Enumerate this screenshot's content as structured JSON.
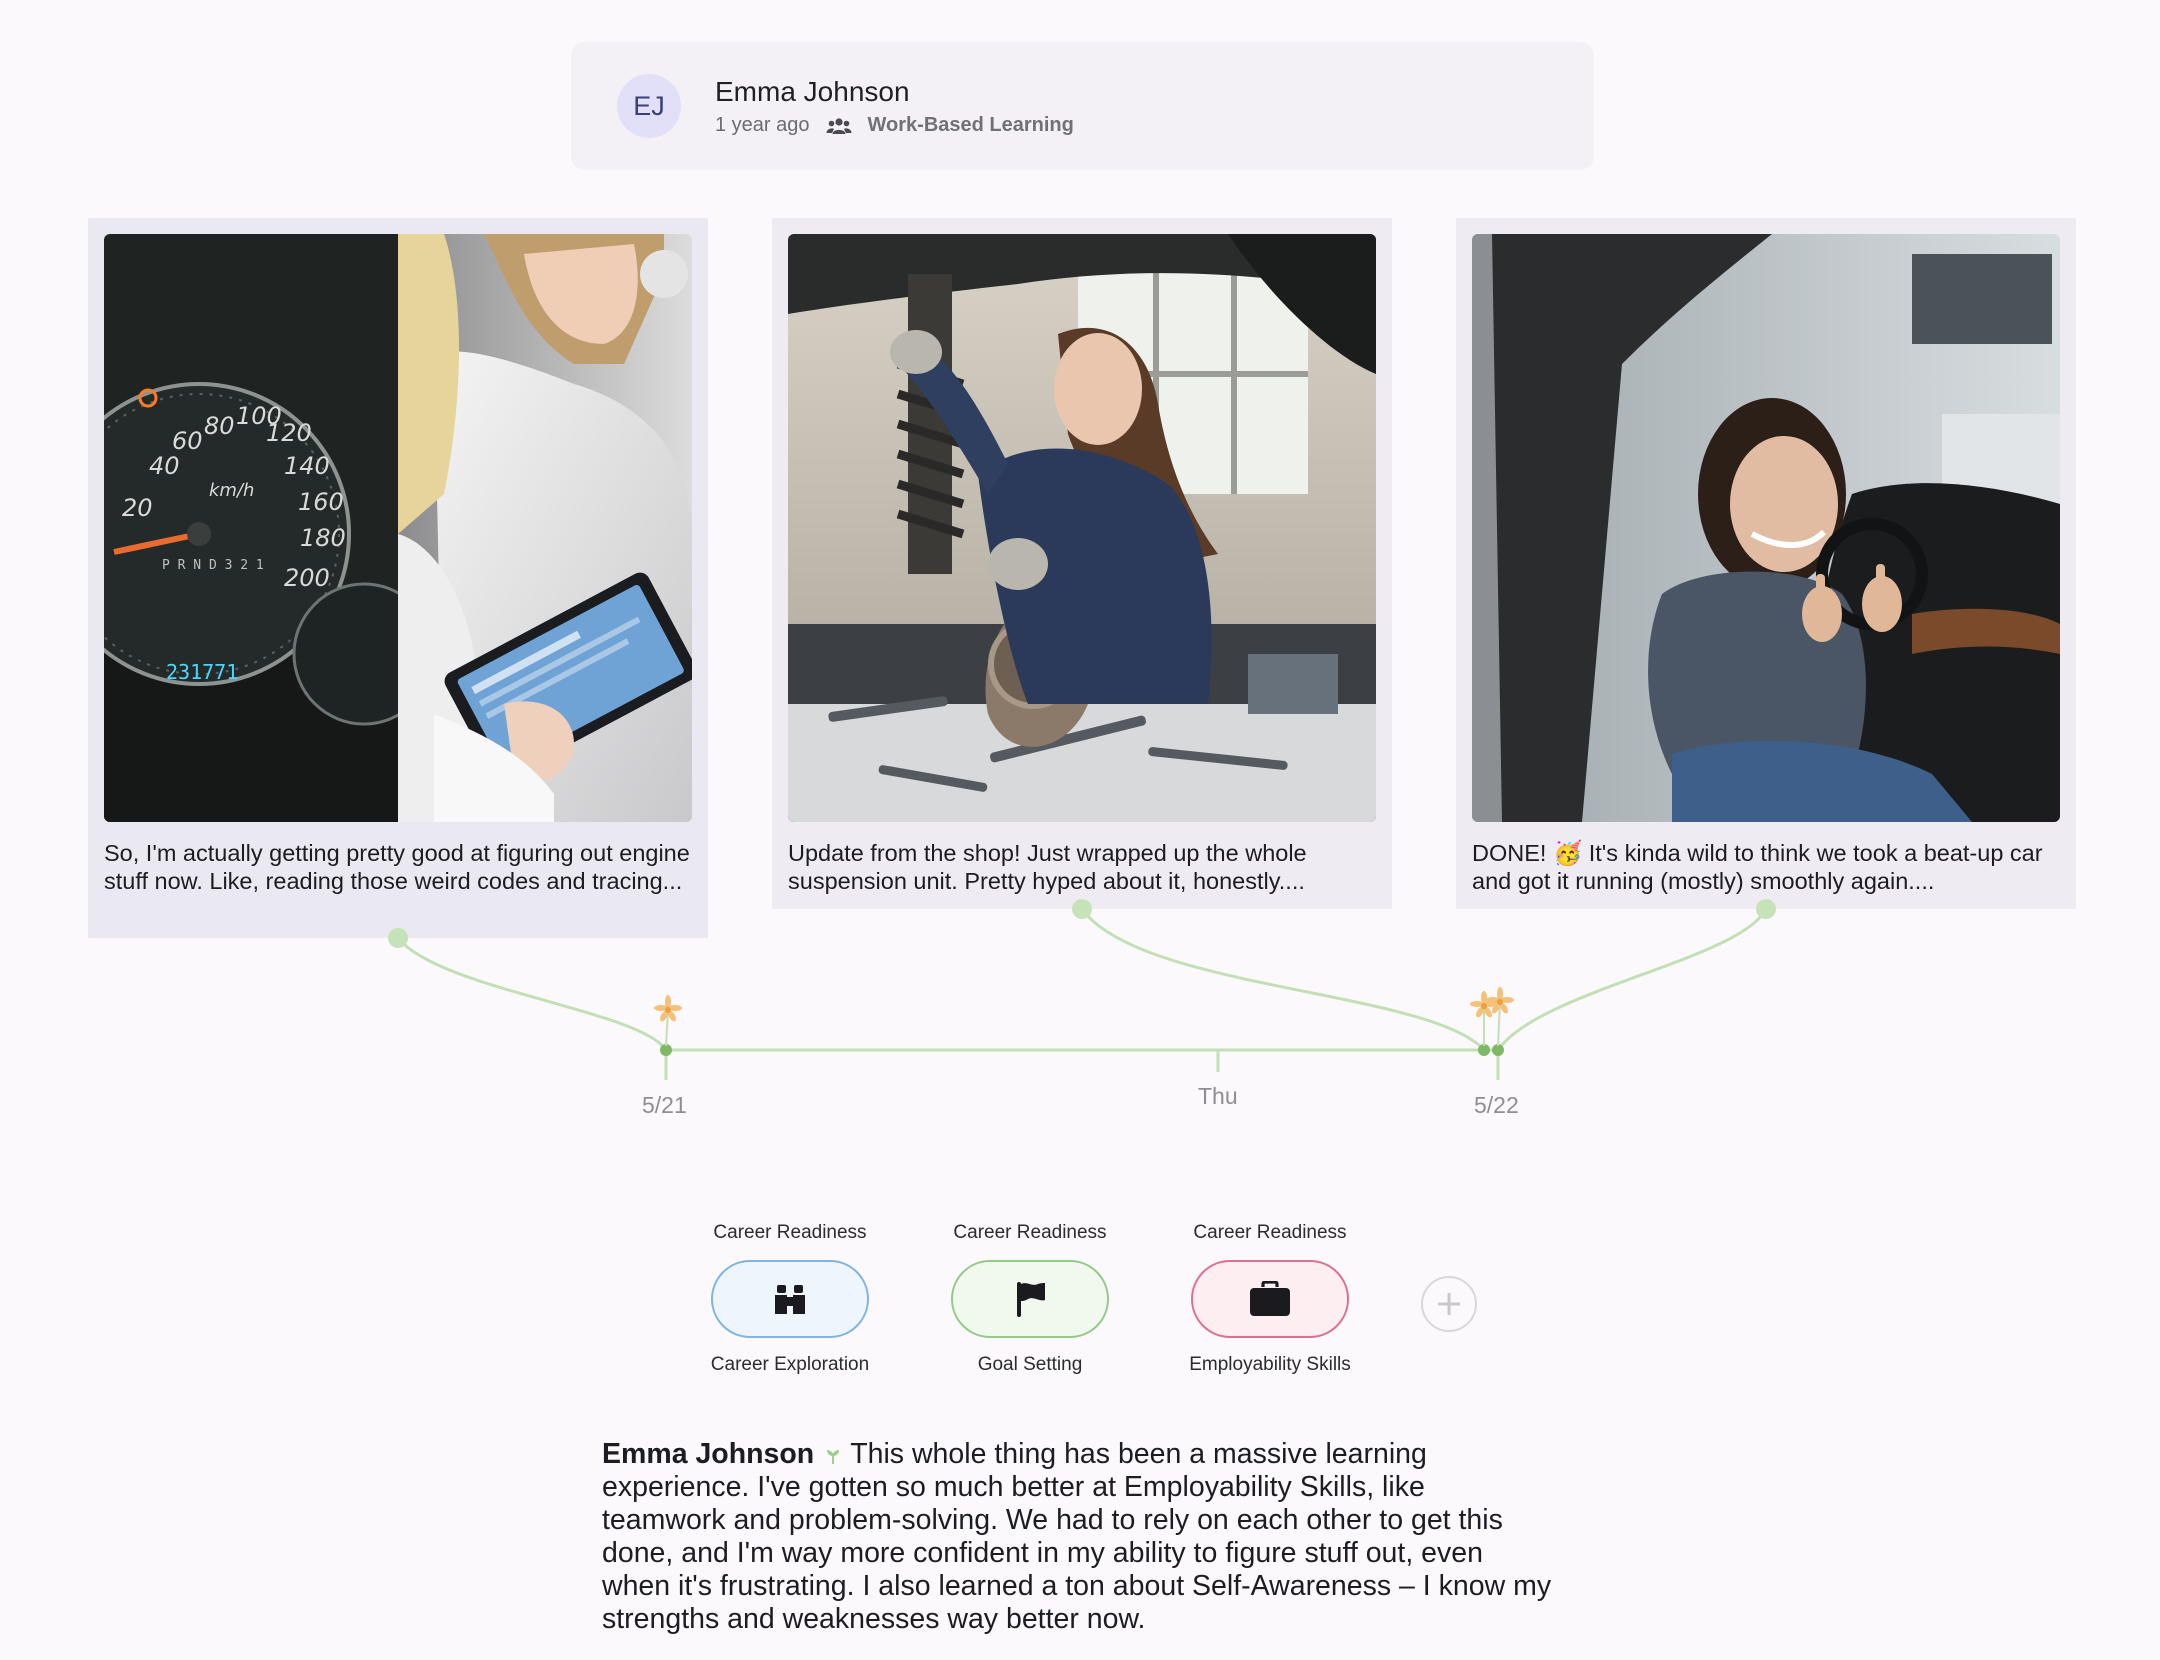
{
  "post": {
    "author": {
      "initials": "EJ",
      "name": "Emma Johnson"
    },
    "timestamp": "1 year ago",
    "group": {
      "icon": "group-icon",
      "name": "Work-Based Learning"
    }
  },
  "entries": [
    {
      "image_icon": "dashboard-and-tablet-photo",
      "caption": "So, I'm actually getting pretty good at figuring out engine stuff now. Like, reading those weird codes and tracing...",
      "speedometer_labels": [
        "20",
        "40",
        "60",
        "80",
        "100",
        "120",
        "140",
        "160",
        "180",
        "200"
      ],
      "speedometer_unit": "km/h",
      "gear_indicator": "P R N D 3 2 1",
      "odometer": "231771"
    },
    {
      "image_icon": "suspension-repair-photo",
      "caption": "Update from the shop! Just wrapped up the whole suspension unit. Pretty hyped about it, honestly...."
    },
    {
      "image_icon": "car-thumbs-up-photo",
      "caption": "DONE! 🥳 It's kinda wild to think we took a beat-up car and got it running (mostly) smoothly again...."
    }
  ],
  "timeline": {
    "ticks": [
      {
        "label": "5/21"
      },
      {
        "label": "Thu"
      },
      {
        "label": "5/22"
      }
    ],
    "colors": {
      "line": "#c3dfb6",
      "node": "#7fb864",
      "flower": "#f5c07a"
    }
  },
  "skills": [
    {
      "category": "Career Readiness",
      "name": "Career Exploration",
      "icon": "binoculars-icon",
      "border": "#7fb4e3",
      "bg": "#eff5fc"
    },
    {
      "category": "Career Readiness",
      "name": "Goal Setting",
      "icon": "flag-icon",
      "border": "#95c98a",
      "bg": "#f1f8ee"
    },
    {
      "category": "Career Readiness",
      "name": "Employability Skills",
      "icon": "briefcase-icon",
      "border": "#df6f8e",
      "bg": "#fdeef2"
    }
  ],
  "add_skill_icon": "plus-icon",
  "reflection": {
    "author": "Emma Johnson",
    "text": "This whole thing has been a massive learning experience. I've gotten so much better at Employability Skills, like teamwork and problem-solving. We had to rely on each other to get this done, and I'm way more confident in my ability to figure stuff out, even when it's frustrating. I also learned a ton about Self-Awareness – I know my strengths and weaknesses way better now."
  }
}
